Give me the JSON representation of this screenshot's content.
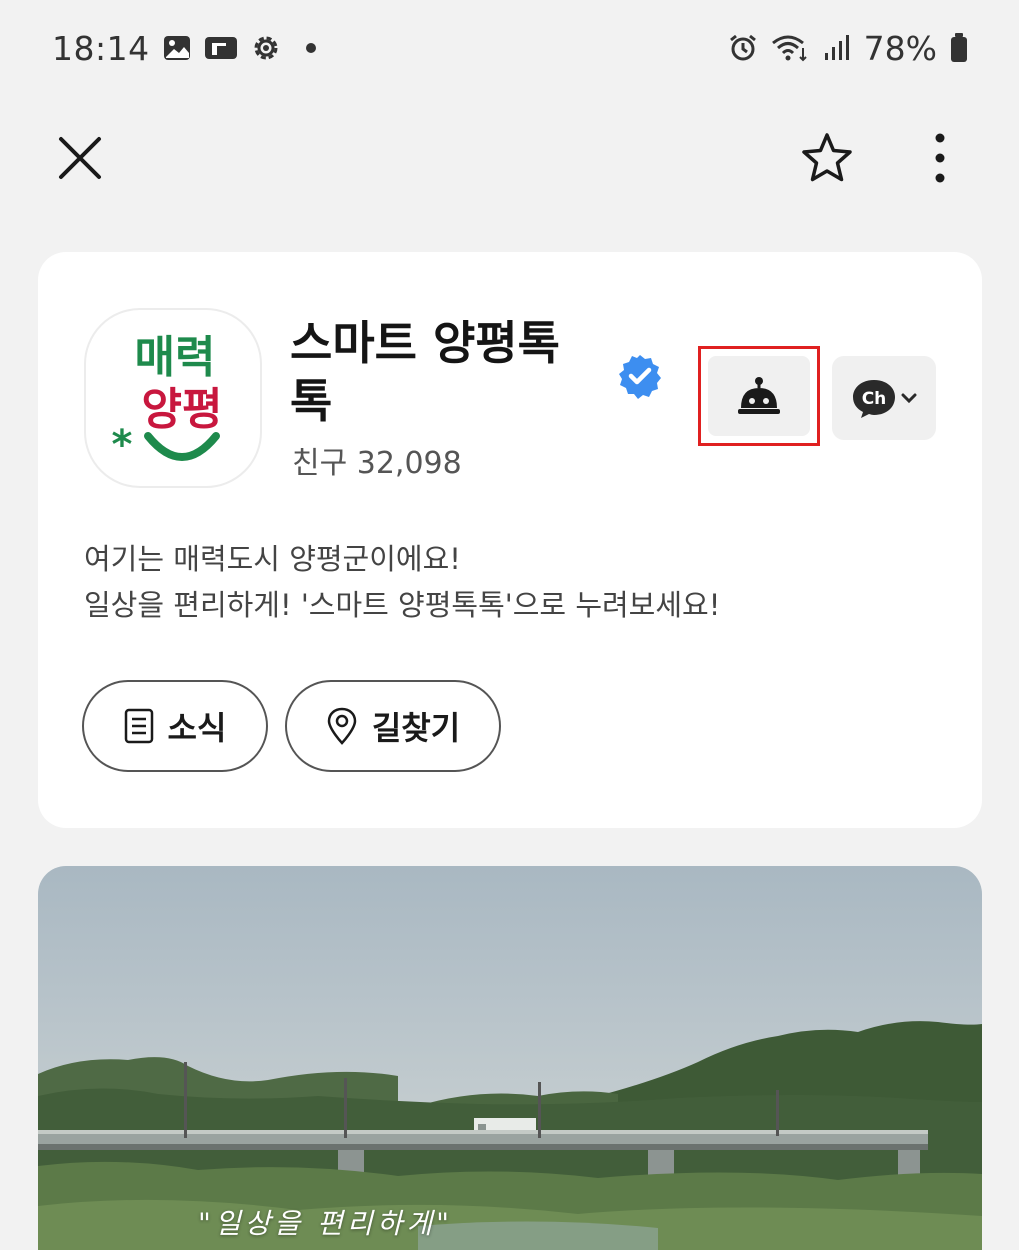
{
  "status_bar": {
    "time": "18:14",
    "left_icons": [
      "gallery-icon",
      "app-icon",
      "settings-icon",
      "notification-dot"
    ],
    "right_icons": [
      "alarm-icon",
      "wifi-icon",
      "signal-icon",
      "battery-icon"
    ],
    "battery": "78%"
  },
  "top_bar": {
    "icons": [
      "close-icon",
      "star-icon",
      "more-vertical-icon"
    ]
  },
  "profile": {
    "logo_lines": [
      "매력",
      "양평"
    ],
    "name": "스마트 양평톡톡",
    "verified": true,
    "friends_label": "친구",
    "friends_count": "32,098",
    "description_line1": "여기는 매력도시 양평군이에요!",
    "description_line2": "일상을 편리하게! '스마트 양평톡톡'으로 누려보세요!",
    "chatbot_icon": "chatbot-bell-icon",
    "channel_icon_text": "Ch",
    "buttons": {
      "news": "소식",
      "directions": "길찾기"
    }
  },
  "banner": {
    "caption": "\"일상을 편리하게\""
  },
  "colors": {
    "background": "#f2f2f2",
    "card": "#ffffff",
    "logo_green": "#1e8a4c",
    "logo_red": "#c8173e",
    "verified_blue": "#3d8ef0",
    "highlight": "#e02020"
  }
}
